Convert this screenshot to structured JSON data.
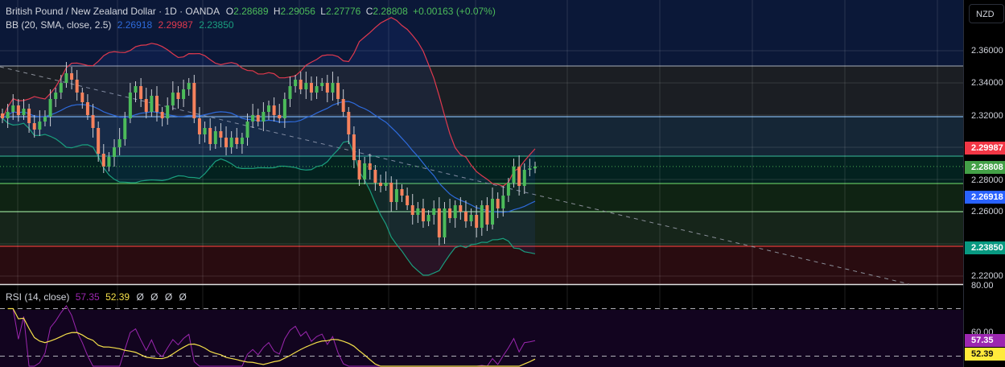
{
  "header": {
    "symbol": "British Pound / New Zealand Dollar · 1D · OANDA",
    "o_label": "O",
    "o": "2.28689",
    "h_label": "H",
    "h": "2.29056",
    "l_label": "L",
    "l": "2.27776",
    "c_label": "C",
    "c": "2.28808",
    "change": "+0.00163 (+0.07%)"
  },
  "bb": {
    "label": "BB (20, SMA, close, 2.5)",
    "basis": "2.26918",
    "upper": "2.29987",
    "lower": "2.23850"
  },
  "rsi": {
    "label": "RSI (14, close)",
    "value": "57.35",
    "ma": "52.39",
    "extras": [
      "Ø",
      "Ø",
      "Ø",
      "Ø"
    ]
  },
  "axis": {
    "currency": "NZD",
    "ticks": [
      "2.36000",
      "2.34000",
      "2.32000",
      "2.28000",
      "2.26000",
      "2.22000"
    ],
    "rsi_ticks": [
      "80.00",
      "60.00"
    ],
    "badges": {
      "upper": "2.29987",
      "last": "2.28808",
      "basis": "2.26918",
      "lower": "2.23850",
      "rsi": "57.35",
      "rsi_ma": "52.39"
    }
  },
  "colors": {
    "up": "#4cbb5a",
    "down": "#f7825d",
    "upper": "#e0394e",
    "basis": "#2e6bdc",
    "lower": "#1a9e7f",
    "rsi": "#9c27b0",
    "rsi_ma": "#f5e04a"
  },
  "chart_data": {
    "type": "candlestick",
    "title": "British Pound / New Zealand Dollar · 1D · OANDA",
    "ylim": [
      2.215,
      2.375
    ],
    "ytick_values": [
      2.36,
      2.34,
      2.32,
      2.28,
      2.26,
      2.22
    ],
    "zones": [
      2.3505,
      2.319,
      2.2945,
      2.2775,
      2.26,
      2.2385
    ],
    "closes": [
      2.318,
      2.322,
      2.326,
      2.32,
      2.324,
      2.315,
      2.311,
      2.316,
      2.319,
      2.33,
      2.334,
      2.34,
      2.346,
      2.342,
      2.334,
      2.328,
      2.32,
      2.312,
      2.296,
      2.288,
      2.294,
      2.3,
      2.305,
      2.318,
      2.334,
      2.338,
      2.33,
      2.322,
      2.332,
      2.322,
      2.318,
      2.326,
      2.334,
      2.33,
      2.336,
      2.34,
      2.318,
      2.308,
      2.312,
      2.302,
      2.31,
      2.306,
      2.3,
      2.306,
      2.302,
      2.306,
      2.316,
      2.32,
      2.316,
      2.322,
      2.326,
      2.32,
      2.318,
      2.33,
      2.338,
      2.342,
      2.336,
      2.34,
      2.334,
      2.338,
      2.34,
      2.334,
      2.34,
      2.33,
      2.322,
      2.308,
      2.292,
      2.28,
      2.29,
      2.286,
      2.278,
      2.276,
      2.278,
      2.266,
      2.274,
      2.27,
      2.264,
      2.258,
      2.262,
      2.254,
      2.258,
      2.262,
      2.244,
      2.262,
      2.256,
      2.264,
      2.26,
      2.254,
      2.258,
      2.25,
      2.264,
      2.252,
      2.268,
      2.262,
      2.27,
      2.278,
      2.288,
      2.276,
      2.286,
      2.28689,
      2.28808
    ],
    "last_price": 2.28808,
    "rsi_levels": [
      70,
      50
    ],
    "rsi_ylim": [
      40,
      90
    ]
  }
}
